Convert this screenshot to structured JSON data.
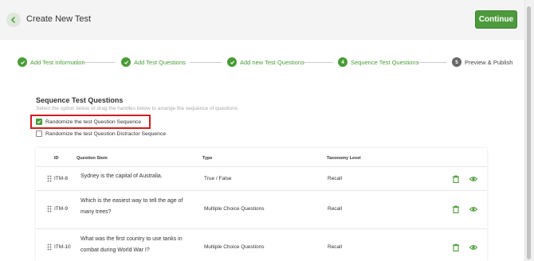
{
  "header": {
    "title": "Create New Test",
    "continue_label": "Continue"
  },
  "stepper": [
    {
      "label": "Add Test Information",
      "status": "done"
    },
    {
      "label": "Add Test Questions",
      "status": "done"
    },
    {
      "label": "Add new Test Questions",
      "status": "done"
    },
    {
      "number": "4",
      "label": "Sequence Test Questions",
      "status": "active"
    },
    {
      "number": "5",
      "label": "Preview & Publish",
      "status": "pending"
    }
  ],
  "section": {
    "title": "Sequence Test Questions",
    "subtitle": "Select the option below or drag the handles below to arrange the sequence of questions"
  },
  "options": [
    {
      "label": "Randomize the test Question Sequence",
      "checked": true
    },
    {
      "label": "Randomize the test Question Distractor Sequence",
      "checked": false
    }
  ],
  "table": {
    "headers": [
      "ID",
      "Question Stem",
      "Type",
      "Taxonomy Level"
    ],
    "rows": [
      {
        "id": "ITM-8",
        "stem": [
          "Sydney is the capital of Australia."
        ],
        "type": "True / False",
        "level": "Recall"
      },
      {
        "id": "ITM-9",
        "stem": [
          "Which is the easiest way to tell the age of",
          "many trees?"
        ],
        "type": "Multiple Choice Questions",
        "level": "Recall"
      },
      {
        "id": "ITM-10",
        "stem": [
          "What was the first country to use tanks in",
          "combat during World War I?"
        ],
        "type": "Multiple Choice Questions",
        "level": "Recall"
      }
    ]
  },
  "colors": {
    "accent": "#4a9c37",
    "continue_bg": "#4c9a3c",
    "highlight": "#d21c1c"
  },
  "icons": {
    "back": "chevron-left-icon",
    "done": "check-icon",
    "delete": "trash-icon",
    "view": "eye-icon",
    "drag": "drag-handle-icon"
  }
}
